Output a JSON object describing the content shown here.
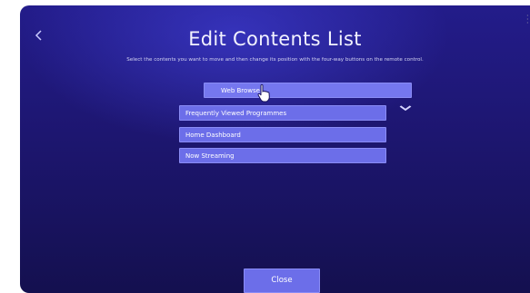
{
  "header": {
    "back_icon": "chevron-left-icon",
    "title": "Edit Contents List",
    "subtitle": "Select the contents you want to move and then change its position with the four-way buttons on the remote control."
  },
  "list": {
    "items": [
      {
        "label": "Web Browser",
        "selected": true
      },
      {
        "label": "Frequently Viewed Programmes",
        "selected": false
      },
      {
        "label": "Home Dashboard",
        "selected": false
      },
      {
        "label": "Now Streaming",
        "selected": false
      }
    ],
    "move_indicator_icon": "chevron-down-icon",
    "pointer_icon": "hand-pointer-icon"
  },
  "footer": {
    "close_label": "Close"
  },
  "colors": {
    "background_top": "#231c8a",
    "background_bottom": "#14104f",
    "item_fill": "#6c6ee9",
    "text": "#ffffff"
  }
}
